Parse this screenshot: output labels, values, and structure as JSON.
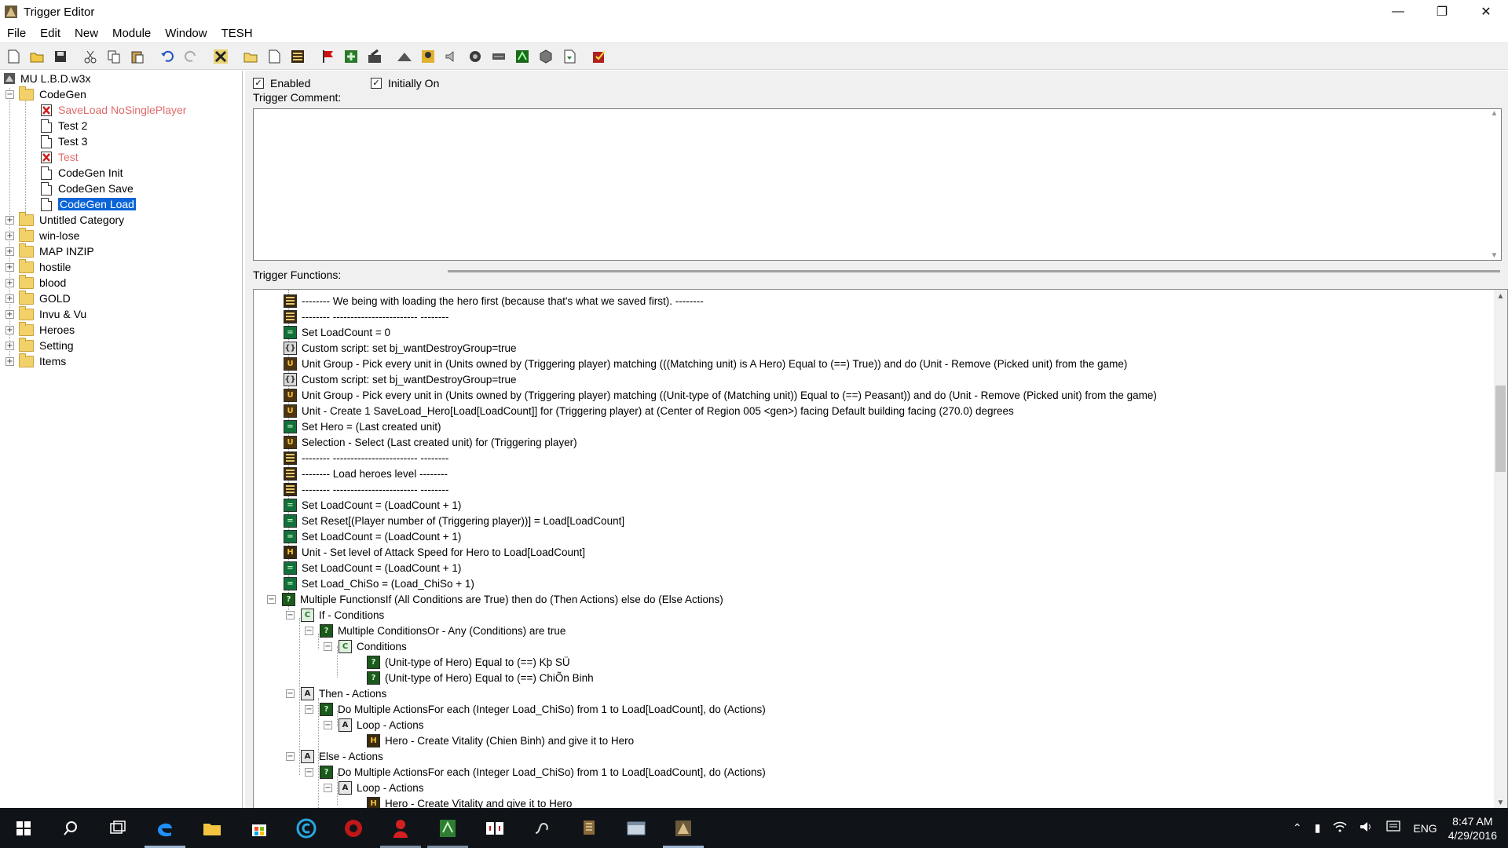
{
  "window": {
    "title": "Trigger Editor"
  },
  "menu": [
    "File",
    "Edit",
    "New",
    "Module",
    "Window",
    "TESH"
  ],
  "toolbar_icons": [
    "new-map-icon",
    "open-icon",
    "save-icon",
    "cut-icon",
    "copy-icon",
    "paste-icon",
    "undo-icon",
    "redo-icon",
    "delete-icon",
    "new-category-icon",
    "new-trigger-icon",
    "new-comment-icon",
    "new-event-icon",
    "new-condition-icon",
    "new-action-icon",
    "terrain-editor-icon",
    "unit-editor-icon",
    "sound-editor-icon",
    "object-editor-icon",
    "campaign-editor-icon",
    "ai-editor-icon",
    "object-manager-icon",
    "import-manager-icon",
    "test-map-icon"
  ],
  "tree": {
    "root": "MU L.B.D.w3x",
    "open_category": "CodeGen",
    "children": [
      {
        "label": "SaveLoad NoSinglePlayer",
        "status": "disabled"
      },
      {
        "label": "Test 2",
        "status": "ok"
      },
      {
        "label": "Test 3",
        "status": "ok"
      },
      {
        "label": "Test",
        "status": "disabled"
      },
      {
        "label": "CodeGen Init",
        "status": "ok"
      },
      {
        "label": "CodeGen Save",
        "status": "ok"
      },
      {
        "label": "CodeGen Load",
        "status": "selected"
      }
    ],
    "categories": [
      "Untitled Category",
      "win-lose",
      "MAP INZIP",
      "hostile",
      "blood",
      "GOLD",
      "Invu & Vu",
      "Heroes",
      "Setting",
      "Items"
    ]
  },
  "trigger": {
    "enabled_label": "Enabled",
    "initially_on_label": "Initially On",
    "comment_label": "Trigger Comment:",
    "functions_label": "Trigger Functions:"
  },
  "functions": [
    {
      "indent": 0,
      "icon": "comment",
      "text": "-------- We being with loading the hero first (because that's what we saved first). --------"
    },
    {
      "indent": 0,
      "icon": "comment",
      "text": "-------- ------------------------ --------"
    },
    {
      "indent": 0,
      "icon": "set",
      "text": "Set LoadCount = 0"
    },
    {
      "indent": 0,
      "icon": "custom",
      "text": "Custom script:   set bj_wantDestroyGroup=true"
    },
    {
      "indent": 0,
      "icon": "unit",
      "text": "Unit Group - Pick every unit in (Units owned by (Triggering player) matching (((Matching unit) is A Hero) Equal to (==) True)) and do (Unit - Remove (Picked unit) from the game)"
    },
    {
      "indent": 0,
      "icon": "custom",
      "text": "Custom script:   set bj_wantDestroyGroup=true"
    },
    {
      "indent": 0,
      "icon": "unit",
      "text": "Unit Group - Pick every unit in (Units owned by (Triggering player) matching ((Unit-type of (Matching unit)) Equal to (==) Peasant)) and do (Unit - Remove (Picked unit) from the game)"
    },
    {
      "indent": 0,
      "icon": "unit",
      "text": "Unit - Create 1 SaveLoad_Hero[Load[LoadCount]] for (Triggering player) at (Center of Region 005 <gen>) facing Default building facing (270.0) degrees"
    },
    {
      "indent": 0,
      "icon": "set",
      "text": "Set Hero = (Last created unit)"
    },
    {
      "indent": 0,
      "icon": "unit",
      "text": "Selection - Select (Last created unit) for (Triggering player)"
    },
    {
      "indent": 0,
      "icon": "comment",
      "text": "-------- ------------------------ --------"
    },
    {
      "indent": 0,
      "icon": "comment",
      "text": "-------- Load heroes level --------"
    },
    {
      "indent": 0,
      "icon": "comment",
      "text": "-------- ------------------------ --------"
    },
    {
      "indent": 0,
      "icon": "set",
      "text": "Set LoadCount = (LoadCount + 1)"
    },
    {
      "indent": 0,
      "icon": "set",
      "text": "Set Reset[(Player number of (Triggering player))] = Load[LoadCount]"
    },
    {
      "indent": 0,
      "icon": "set",
      "text": "Set LoadCount = (LoadCount + 1)"
    },
    {
      "indent": 0,
      "icon": "hero",
      "text": "Unit - Set level of Attack Speed  for Hero to Load[LoadCount]"
    },
    {
      "indent": 0,
      "icon": "set",
      "text": "Set LoadCount = (LoadCount + 1)"
    },
    {
      "indent": 0,
      "icon": "set",
      "text": "Set Load_ChiSo = (Load_ChiSo + 1)"
    },
    {
      "indent": 0,
      "icon": "q",
      "text": "Multiple FunctionsIf (All Conditions are True) then do (Then Actions) else do (Else Actions)",
      "exp": true
    },
    {
      "indent": 1,
      "icon": "cond",
      "text": "If - Conditions",
      "exp": true
    },
    {
      "indent": 2,
      "icon": "q",
      "text": "Multiple ConditionsOr - Any (Conditions) are true",
      "exp": true
    },
    {
      "indent": 3,
      "icon": "cond",
      "text": "Conditions",
      "exp": true
    },
    {
      "indent": 4,
      "icon": "q",
      "text": "(Unit-type of Hero) Equal to (==) Kþ SÜ"
    },
    {
      "indent": 4,
      "icon": "q",
      "text": "(Unit-type of Hero) Equal to (==) ChiÕn Binh"
    },
    {
      "indent": 1,
      "icon": "act",
      "text": "Then - Actions",
      "exp": true
    },
    {
      "indent": 2,
      "icon": "q",
      "text": "Do Multiple ActionsFor each (Integer Load_ChiSo) from 1 to Load[LoadCount], do (Actions)",
      "exp": true
    },
    {
      "indent": 3,
      "icon": "act",
      "text": "Loop - Actions",
      "exp": true
    },
    {
      "indent": 4,
      "icon": "hero",
      "text": "Hero - Create Vitality (Chien Binh) and give it to Hero"
    },
    {
      "indent": 1,
      "icon": "act",
      "text": "Else - Actions",
      "exp": true
    },
    {
      "indent": 2,
      "icon": "q",
      "text": "Do Multiple ActionsFor each (Integer Load_ChiSo) from 1 to Load[LoadCount], do (Actions)",
      "exp": true
    },
    {
      "indent": 3,
      "icon": "act",
      "text": "Loop - Actions",
      "exp": true
    },
    {
      "indent": 4,
      "icon": "hero",
      "text": "Hero - Create Vitality  and give it to Hero"
    }
  ],
  "taskbar": {
    "apps": [
      "start-icon",
      "search-icon",
      "task-view-icon",
      "edge-icon",
      "file-explorer-icon",
      "store-icon",
      "app-c-icon",
      "app-red-icon",
      "app-avatar-icon",
      "app-green-icon",
      "app-cards-icon",
      "app-swirl-icon",
      "app-scroll-icon",
      "app-window-icon",
      "trigger-editor-icon"
    ],
    "lang": "ENG",
    "time": "8:47 AM",
    "date": "4/29/2016"
  }
}
